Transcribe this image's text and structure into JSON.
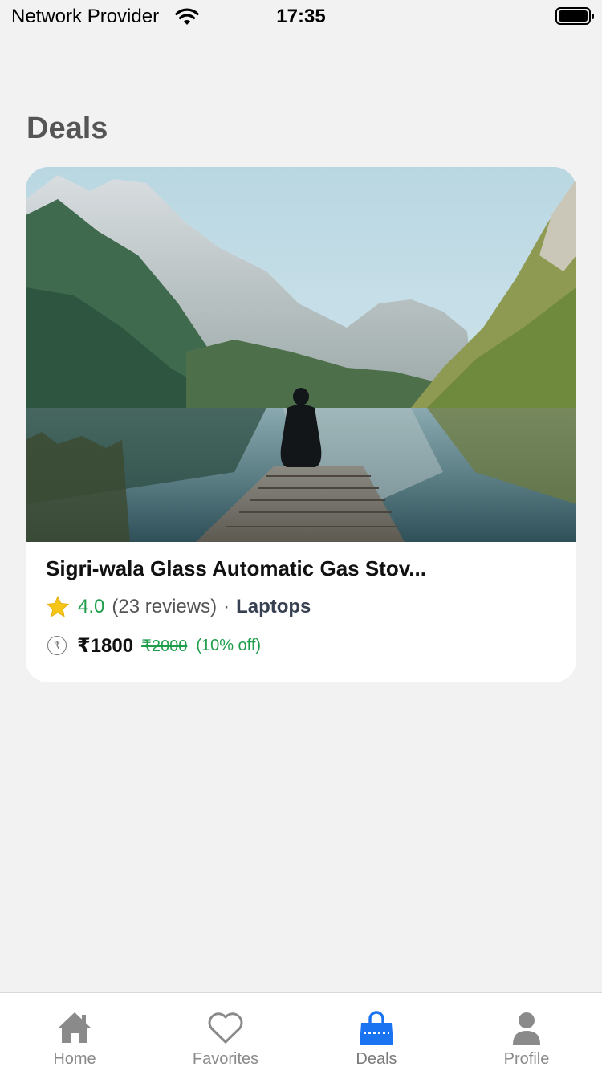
{
  "status_bar": {
    "carrier": "Network Provider",
    "time": "17:35",
    "icons": [
      "wifi-icon",
      "battery-icon"
    ]
  },
  "page": {
    "title": "Deals"
  },
  "deals": [
    {
      "image": "photo of a person sitting on a wooden pier facing a mountain lake",
      "name": "Sigri-wala Glass Automatic Gas Stov...",
      "rating": "4.0",
      "reviews": "(23 reviews)",
      "separator": "·",
      "category": "Laptops",
      "currency_icon": "rupee-icon",
      "price": "₹1800",
      "original_price": "₹2000",
      "discount": "(10% off)"
    }
  ],
  "tab_bar": {
    "active": "Deals",
    "active_color": "#1a73f0",
    "inactive_color": "#8a8a8a",
    "tabs": [
      {
        "label": "Home",
        "icon": "home-icon"
      },
      {
        "label": "Favorites",
        "icon": "heart-icon"
      },
      {
        "label": "Deals",
        "icon": "shopping-bag-icon"
      },
      {
        "label": "Profile",
        "icon": "user-icon"
      }
    ]
  },
  "colors": {
    "background": "#f2f2f2",
    "card": "#ffffff",
    "accent_green": "#1e9e4a",
    "star": "#f5c518"
  }
}
